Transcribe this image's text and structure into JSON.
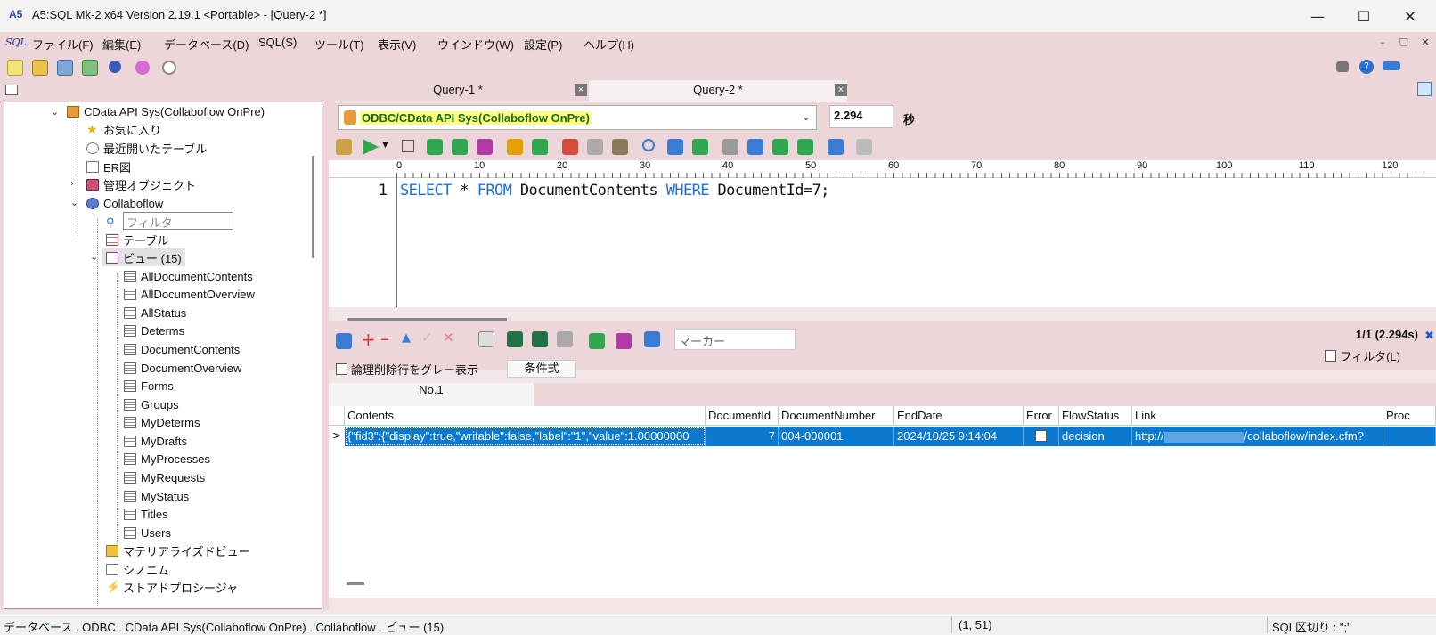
{
  "window": {
    "title": "A5:SQL Mk-2 x64 Version 2.19.1 <Portable> - [Query-2 *]",
    "app_logo": "A5"
  },
  "menu": {
    "sql_logo": "SQL",
    "items": [
      "ファイル(F)",
      "編集(E)",
      "データベース(D)",
      "SQL(S)",
      "ツール(T)",
      "表示(V)",
      "ウインドウ(W)",
      "設定(P)",
      "ヘルプ(H)"
    ]
  },
  "tree": {
    "root": "CData API Sys(Collaboflow OnPre)",
    "favorites": "お気に入り",
    "recent": "最近開いたテーブル",
    "er": "ER図",
    "admin": "管理オブジェクト",
    "schema": "Collaboflow",
    "filter_placeholder": "フィルタ",
    "tables": "テーブル",
    "views": "ビュー (15)",
    "view_items": [
      "AllDocumentContents",
      "AllDocumentOverview",
      "AllStatus",
      "Determs",
      "DocumentContents",
      "DocumentOverview",
      "Forms",
      "Groups",
      "MyDeterms",
      "MyDrafts",
      "MyProcesses",
      "MyRequests",
      "MyStatus",
      "Titles",
      "Users"
    ],
    "mviews": "マテリアライズドビュー",
    "synonyms": "シノニム",
    "procs": "ストアドプロシージャ"
  },
  "tabs": [
    {
      "label": "Query-1 *",
      "close": "×"
    },
    {
      "label": "Query-2 *",
      "close": "×"
    }
  ],
  "connection": {
    "label": "ODBC/CData API Sys(Collaboflow OnPre)",
    "elapsed": "2.294",
    "unit": "秒"
  },
  "ruler": [
    "0",
    "10",
    "20",
    "30",
    "40",
    "50",
    "60",
    "70",
    "80",
    "90",
    "100",
    "110",
    "120"
  ],
  "editor": {
    "line_no": "1",
    "tokens": [
      {
        "t": "SELECT",
        "kw": true
      },
      {
        "t": " * ",
        "kw": false
      },
      {
        "t": "FROM",
        "kw": true
      },
      {
        "t": " DocumentContents ",
        "kw": false
      },
      {
        "t": "WHERE",
        "kw": true
      },
      {
        "t": " DocumentId=7;",
        "kw": false
      }
    ]
  },
  "result": {
    "marker_placeholder": "マーカー",
    "count": "1/1 (2.294s)",
    "filter_label": "フィルタ(L)",
    "gray_label": "論理削除行をグレー表示",
    "cond_button": "条件式",
    "tab": "No.1",
    "columns": [
      "Contents",
      "DocumentId",
      "DocumentNumber",
      "EndDate",
      "Error",
      "FlowStatus",
      "Link",
      "Proc"
    ],
    "row": {
      "marker": ">",
      "contents": "{\"fid3\":{\"display\":true,\"writable\":false,\"label\":\"1\",\"value\":1.00000000",
      "documentid": "7",
      "documentnumber": "004-000001",
      "enddate": "2024/10/25 9:14:04",
      "flowstatus": "decision",
      "link_start": "http://",
      "link_end": "/collaboflow/index.cfm?"
    }
  },
  "status": {
    "path": "データベース . ODBC . CData API Sys(Collaboflow OnPre) . Collaboflow . ビュー (15)",
    "cursor": "(1, 51)",
    "delimiter": "SQL区切り : \";\""
  }
}
